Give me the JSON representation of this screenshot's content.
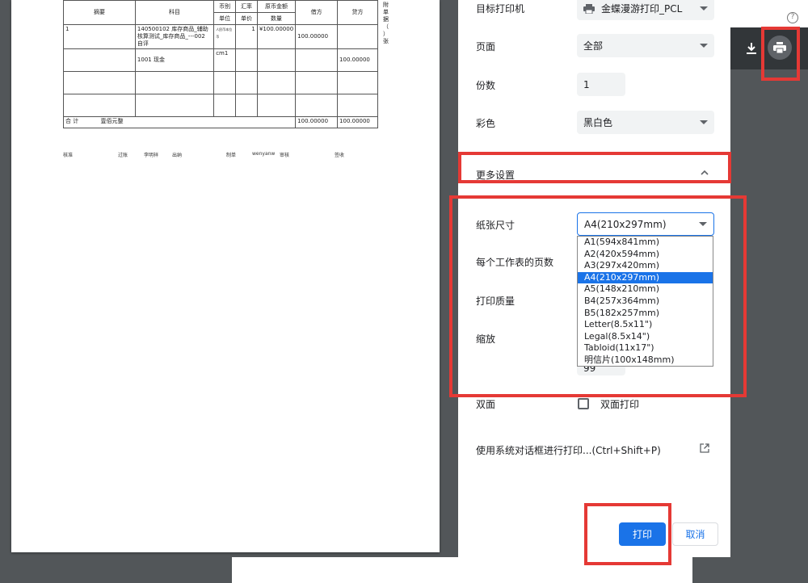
{
  "voucher": {
    "header": {
      "summary": "摘要",
      "subject": "科目",
      "currency": "币别",
      "rate": "汇率",
      "orig_amount": "原币金额",
      "unit": "单位",
      "price": "单价",
      "qty": "数量",
      "debit": "借方",
      "credit": "贷方"
    },
    "rows": [
      {
        "summary": "1",
        "subject": "140500102 库存商品_辅助核算测试_库存商品_---002 自评",
        "unit": "人民币本位币",
        "rate": "1",
        "orig": "¥100.00000",
        "debit": "100.00000",
        "credit": ""
      },
      {
        "summary": "",
        "subject": "1001 现金",
        "unit": "cm1",
        "rate": "",
        "orig": "",
        "debit": "",
        "credit": "100.00000"
      }
    ],
    "total_label": "合 计",
    "total_text": "壹佰元整",
    "total_debit": "100.00000",
    "total_credit": "100.00000",
    "side_note": "附单据（ ）张",
    "signs": {
      "approve": "核准",
      "post": "过账",
      "post_name": "李明祥",
      "cashier": "出纳",
      "maker": "制单",
      "maker_name": "wenyanw",
      "review": "审核",
      "sign": "签收"
    }
  },
  "panel": {
    "destination_label": "目标打印机",
    "destination_value": "金蝶漫游打印_PCL",
    "pages_label": "页面",
    "pages_value": "全部",
    "copies_label": "份数",
    "copies_value": "1",
    "color_label": "彩色",
    "color_value": "黑白色",
    "more_settings": "更多设置",
    "paper_size_label": "纸张尺寸",
    "paper_size_value": "A4(210x297mm)",
    "pages_per_sheet_label": "每个工作表的页数",
    "quality_label": "打印质量",
    "scale_label": "缩放",
    "scale_value_partial": "99",
    "duplex_label": "双面",
    "duplex_option": "双面打印",
    "system_dialog": "使用系统对话框进行打印...(Ctrl+Shift+P)",
    "print_button": "打印",
    "cancel_button": "取消"
  },
  "dropdown_options": [
    "A1(594x841mm)",
    "A2(420x594mm)",
    "A3(297x420mm)",
    "A4(210x297mm)",
    "A5(148x210mm)",
    "B4(257x364mm)",
    "B5(182x257mm)",
    "Letter(8.5x11\")",
    "Legal(8.5x14\")",
    "Tabloid(11x17\")",
    "明信片(100x148mm)"
  ],
  "selected_option": "A4(210x297mm)",
  "toolbar": {
    "help": "?"
  },
  "colors": {
    "accent": "#1a73e8",
    "highlight": "#e53935",
    "dark_toolbar": "#323639"
  }
}
